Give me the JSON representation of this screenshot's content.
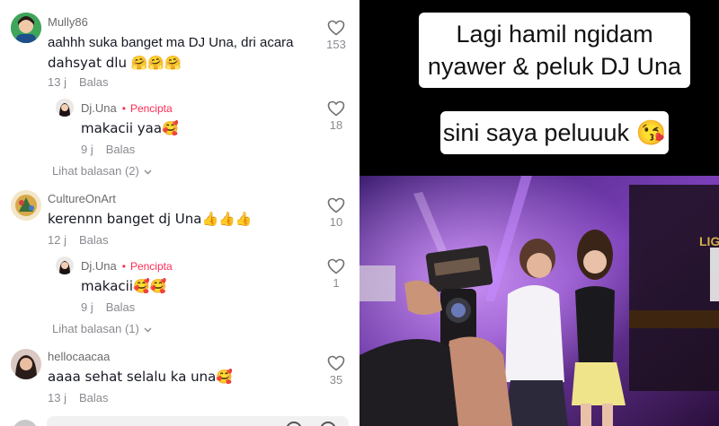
{
  "comments": [
    {
      "username": "Mully86",
      "text_lines": [
        "aahhh suka banget ma DJ Una, dri acara",
        "dahsyat dlu 🤗🤗🤗"
      ],
      "age": "13 j",
      "reply_label": "Balas",
      "likes": "153",
      "reply": {
        "username": "Dj.Una",
        "creator_label": "Pencipta",
        "text": "makacii yaa🥰",
        "age": "9 j",
        "reply_label": "Balas",
        "likes": "18"
      },
      "view_replies": "Lihat balasan (2)"
    },
    {
      "username": "CultureOnArt",
      "text_lines": [
        "kerennn banget dj Una👍👍👍"
      ],
      "age": "12 j",
      "reply_label": "Balas",
      "likes": "10",
      "reply": {
        "username": "Dj.Una",
        "creator_label": "Pencipta",
        "text": "makacii🥰🥰",
        "age": "9 j",
        "reply_label": "Balas",
        "likes": "1"
      },
      "view_replies": "Lihat balasan (1)"
    },
    {
      "username": "hellocaacaa",
      "text_lines": [
        "aaaa sehat selalu ka una🥰"
      ],
      "age": "13 j",
      "reply_label": "Balas",
      "likes": "35"
    }
  ],
  "video": {
    "caption_1": [
      "Lagi hamil ngidam",
      "nyawer & peluk DJ Una"
    ],
    "caption_2": "sini saya peluuuk 😘",
    "sign_text": "LIG"
  },
  "icons": {
    "like": "heart-outline-icon",
    "chevron": "chevron-down-icon"
  },
  "colors": {
    "creator_accent": "#fe2c55",
    "muted_text": "#8a8b91",
    "body_text": "#161823"
  }
}
